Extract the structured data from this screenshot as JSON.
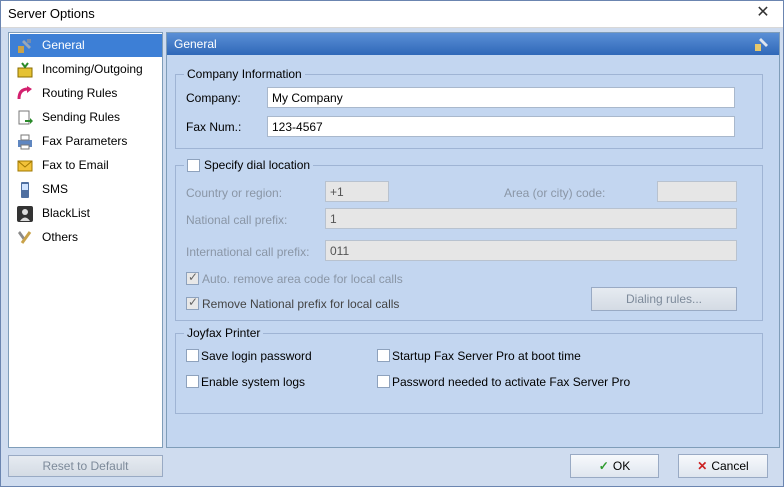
{
  "window": {
    "title": "Server Options",
    "close": "✕"
  },
  "sidebar": {
    "items": [
      {
        "label": "General",
        "icon": "tools-icon"
      },
      {
        "label": "Incoming/Outgoing",
        "icon": "inbox-icon"
      },
      {
        "label": "Routing Rules",
        "icon": "routing-arrow-icon"
      },
      {
        "label": "Sending Rules",
        "icon": "send-document-icon"
      },
      {
        "label": "Fax Parameters",
        "icon": "printer-icon"
      },
      {
        "label": "Fax to Email",
        "icon": "envelope-icon"
      },
      {
        "label": "SMS",
        "icon": "phone-icon"
      },
      {
        "label": "BlackList",
        "icon": "person-silhouette-icon"
      },
      {
        "label": "Others",
        "icon": "wrench-icon"
      }
    ]
  },
  "panel": {
    "title": "General",
    "company": {
      "legend": "Company Information",
      "company_label": "Company:",
      "company_value": "My Company",
      "fax_label": "Fax Num.:",
      "fax_value": "123-4567"
    },
    "dial": {
      "legend": "Specify dial location",
      "country_label": "Country or region:",
      "country_value": "+1",
      "area_label": "Area (or city) code:",
      "area_value": "",
      "national_label": "National call prefix:",
      "national_value": "1",
      "international_label": "International call prefix:",
      "international_value": "011",
      "auto_remove_label": "Auto. remove area code for local calls",
      "remove_national_label": "Remove National prefix for local calls",
      "dialing_rules_button": "Dialing rules..."
    },
    "printer": {
      "legend": "Joyfax Printer",
      "save_login_label": "Save login password",
      "enable_logs_label": "Enable system logs",
      "startup_label": "Startup Fax Server Pro at boot time",
      "password_needed_label": "Password needed to activate Fax Server Pro"
    }
  },
  "footer": {
    "reset_label": "Reset to Default",
    "ok_label": "OK",
    "cancel_label": "Cancel"
  }
}
